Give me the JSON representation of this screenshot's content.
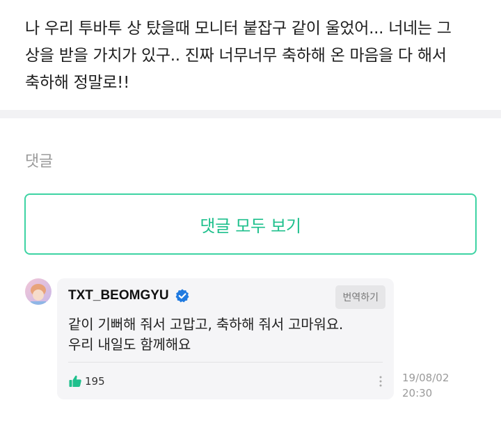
{
  "post": {
    "lines": [
      "나 우리 투바투 상 탔을때 모니터 붙잡구 같이 울었어... 너네는 그",
      "상을 받을 가치가 있구.. 진짜 너무너무 축하해 온 마음을 다 해서",
      "축하해 정말로!!"
    ]
  },
  "comments_section": {
    "label": "댓글",
    "view_all_label": "댓글 모두 보기"
  },
  "comment": {
    "author": "TXT_BEOMGYU",
    "verified_icon": "verified-check-icon",
    "translate_label": "번역하기",
    "text_lines": [
      "같이 기뻐해 줘서 고맙고, 축하해 줘서 고마워요.",
      "우리 내일도 함께해요"
    ],
    "like_icon": "thumbs-up-icon",
    "like_count": "195",
    "more_icon": "more-vertical-icon",
    "date": "19/08/02",
    "time": "20:30"
  },
  "colors": {
    "accent": "#1fc08d",
    "border_accent": "#3dd3a3",
    "verified": "#1f7ae0",
    "like": "#1fc08d"
  }
}
